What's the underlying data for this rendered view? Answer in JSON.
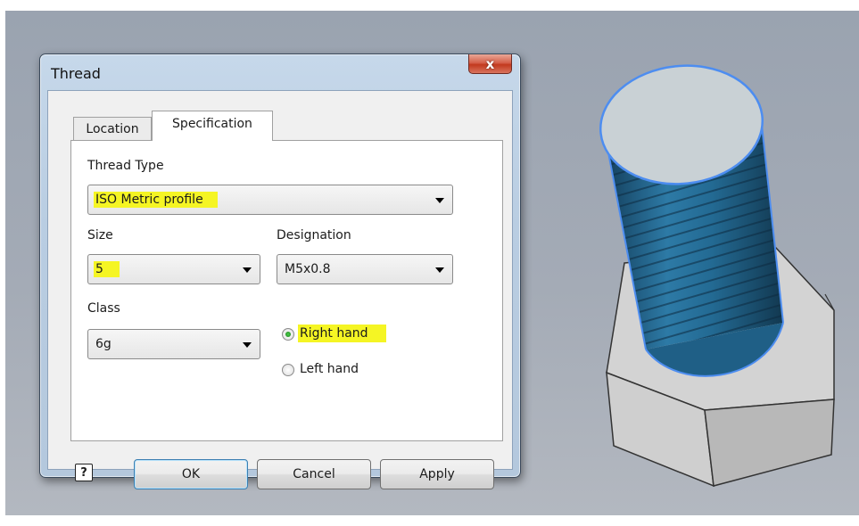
{
  "dialog": {
    "title": "Thread",
    "close_label": "x",
    "tabs": [
      {
        "label": "Location",
        "active": false
      },
      {
        "label": "Specification",
        "active": true
      }
    ],
    "thread_type": {
      "label": "Thread Type",
      "value": "ISO Metric profile"
    },
    "size": {
      "label": "Size",
      "value": "5"
    },
    "designation": {
      "label": "Designation",
      "value": "M5x0.8"
    },
    "class": {
      "label": "Class",
      "value": "6g"
    },
    "hand": {
      "options": [
        {
          "label": "Right hand",
          "checked": true
        },
        {
          "label": "Left hand",
          "checked": false
        }
      ]
    },
    "buttons": {
      "help": "?",
      "ok": "OK",
      "cancel": "Cancel",
      "apply": "Apply"
    }
  },
  "colors": {
    "highlight": "#f5f524",
    "thread_blue": "#1f5f86",
    "selection_outline": "#4d8df0",
    "viewport_bg": "#a4abb6"
  },
  "model": {
    "icon": "hex-bolt-3d-model"
  }
}
